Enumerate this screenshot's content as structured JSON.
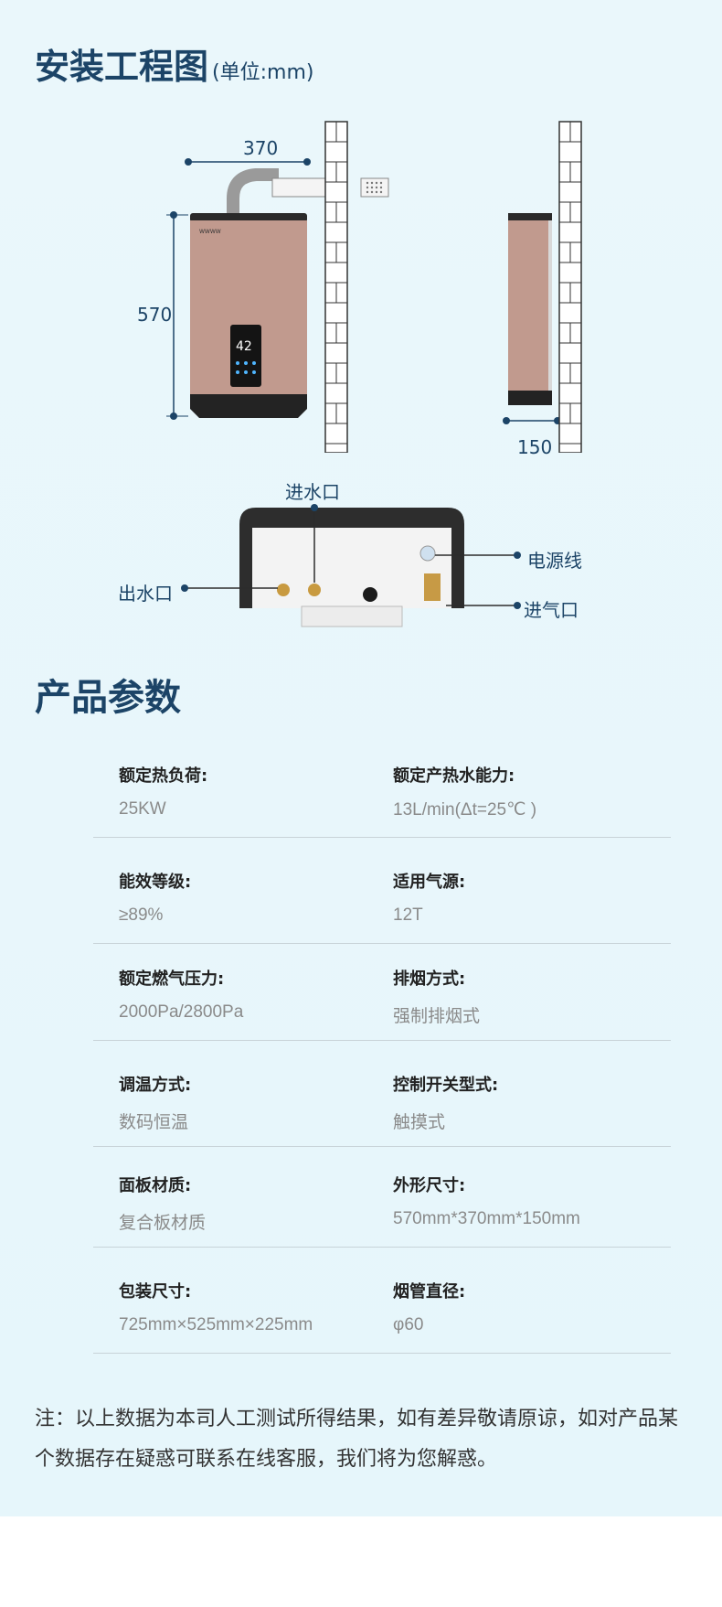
{
  "install": {
    "title": "安装工程图",
    "unit": "(单位:mm)",
    "dim_width": "370",
    "dim_height": "570",
    "dim_depth": "150",
    "ports": {
      "water_in": "进水口",
      "water_out": "出水口",
      "power": "电源线",
      "gas_in": "进气口"
    },
    "display_temp": "42"
  },
  "params": {
    "title": "产品参数",
    "rows": [
      {
        "l1": "额定热负荷:",
        "v1": "25KW",
        "l2": "额定产热水能力:",
        "v2": "13L/min(Δt=25℃ )"
      },
      {
        "l1": "能效等级:",
        "v1": "≥89%",
        "l2": "适用气源:",
        "v2": "12T"
      },
      {
        "l1": "额定燃气压力:",
        "v1": "2000Pa/2800Pa",
        "l2": "排烟方式:",
        "v2": "强制排烟式"
      },
      {
        "l1": "调温方式:",
        "v1": "数码恒温",
        "l2": "控制开关型式:",
        "v2": "触摸式"
      },
      {
        "l1": "面板材质:",
        "v1": "复合板材质",
        "l2": "外形尺寸:",
        "v2": "570mm*370mm*150mm"
      },
      {
        "l1": "包装尺寸:",
        "v1": "725mm×525mm×225mm",
        "l2": "烟管直径:",
        "v2": "φ60"
      }
    ]
  },
  "note": "注：以上数据为本司人工测试所得结果，如有差异敬请原谅，如对产品某个数据存在疑惑可联系在线客服，我们将为您解惑。"
}
